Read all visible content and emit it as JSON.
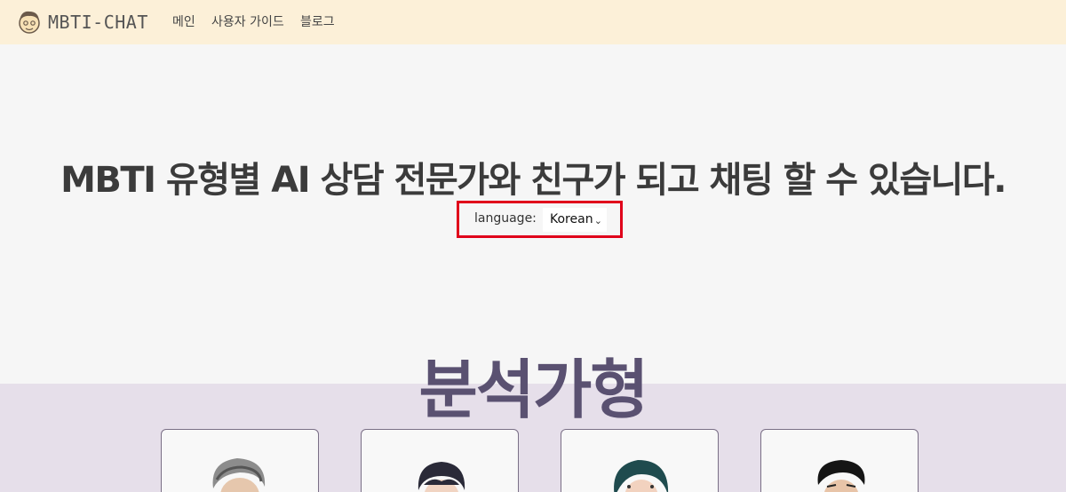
{
  "nav": {
    "brand": "MBTI-CHAT",
    "links": [
      "메인",
      "사용자 가이드",
      "블로그"
    ]
  },
  "hero": {
    "headline": "MBTI 유형별 AI 상담 전문가와 친구가 되고 채팅 할 수 있습니다.",
    "language_label": "language:",
    "language_value": "Korean"
  },
  "section": {
    "title": "분석가형"
  },
  "colors": {
    "navbar_bg": "#fcf0d8",
    "page_bg": "#f6f6f6",
    "section_band": "#e6dfea",
    "section_title": "#5a5171",
    "highlight": "#e0001a"
  }
}
